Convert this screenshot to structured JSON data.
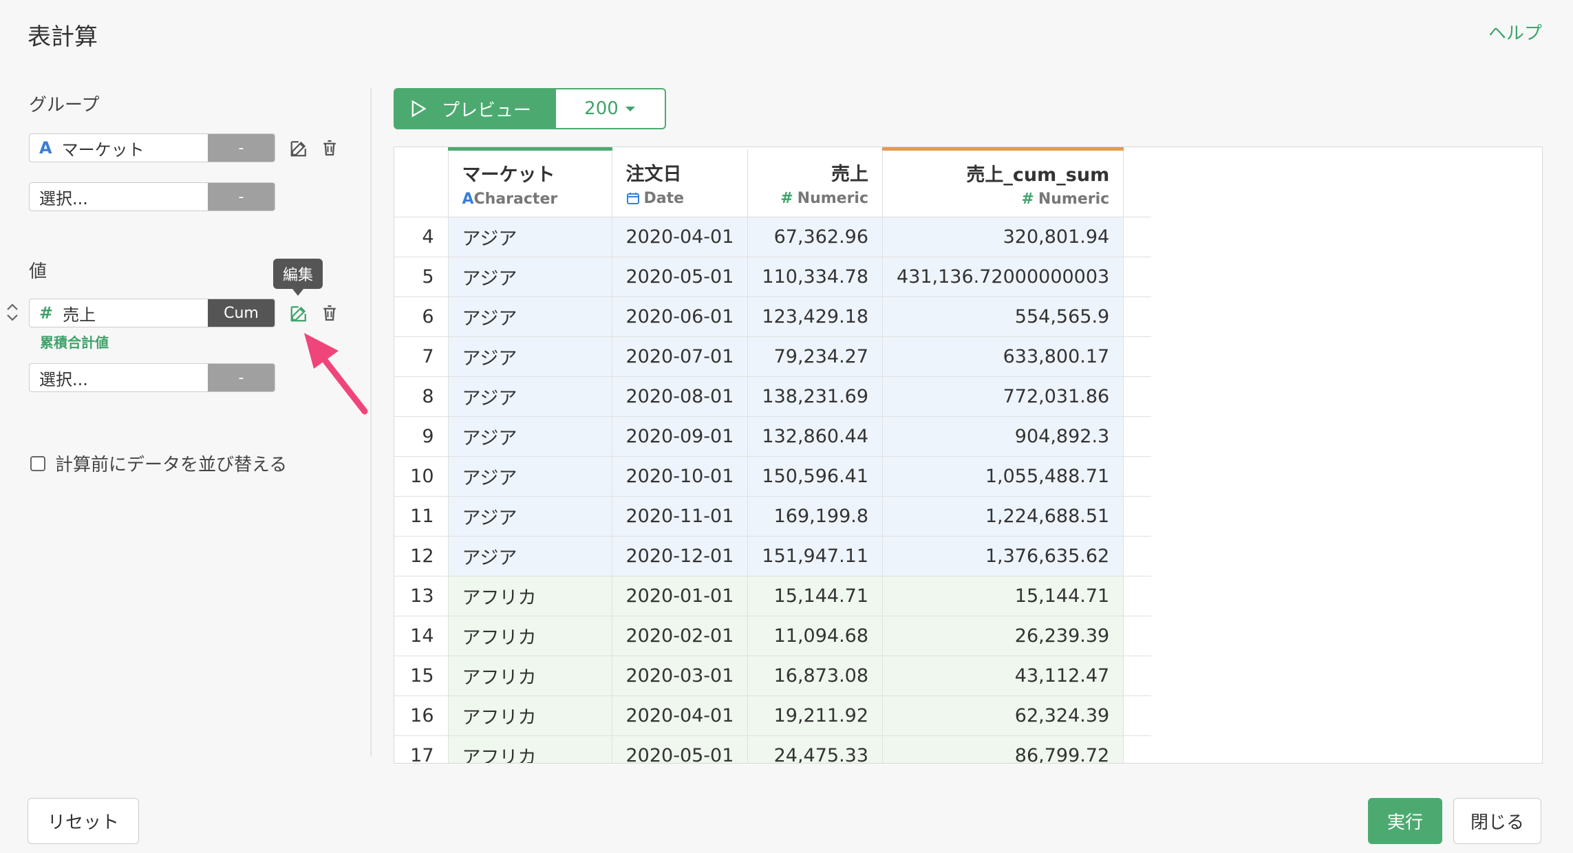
{
  "header": {
    "title": "表計算",
    "help": "ヘルプ"
  },
  "left": {
    "group_label": "グループ",
    "group_field": {
      "name": "マーケット",
      "type_icon": "A",
      "agg": "-"
    },
    "group_select": {
      "placeholder": "選択...",
      "agg": "-"
    },
    "value_label": "値",
    "tooltip": "編集",
    "value_field": {
      "name": "売上",
      "type_icon": "#",
      "agg": "Cum",
      "sublabel": "累積合計値"
    },
    "value_select": {
      "placeholder": "選択...",
      "agg": "-"
    },
    "sort_checkbox": {
      "label": "計算前にデータを並び替える",
      "checked": false
    }
  },
  "preview": {
    "label": "プレビュー",
    "count": "200"
  },
  "table": {
    "columns": [
      {
        "name": "マーケット",
        "type": "Character",
        "type_icon": "A"
      },
      {
        "name": "注文日",
        "type": "Date",
        "type_icon": "calendar"
      },
      {
        "name": "売上",
        "type": "Numeric",
        "type_icon": "#"
      },
      {
        "name": "売上_cum_sum",
        "type": "Numeric",
        "type_icon": "#"
      }
    ],
    "rows": [
      {
        "n": "4",
        "market": "アジア",
        "date": "2020-04-01",
        "sales": "67,362.96",
        "cum": "320,801.94",
        "group": "asia"
      },
      {
        "n": "5",
        "market": "アジア",
        "date": "2020-05-01",
        "sales": "110,334.78",
        "cum": "431,136.72000000003",
        "group": "asia"
      },
      {
        "n": "6",
        "market": "アジア",
        "date": "2020-06-01",
        "sales": "123,429.18",
        "cum": "554,565.9",
        "group": "asia"
      },
      {
        "n": "7",
        "market": "アジア",
        "date": "2020-07-01",
        "sales": "79,234.27",
        "cum": "633,800.17",
        "group": "asia"
      },
      {
        "n": "8",
        "market": "アジア",
        "date": "2020-08-01",
        "sales": "138,231.69",
        "cum": "772,031.86",
        "group": "asia"
      },
      {
        "n": "9",
        "market": "アジア",
        "date": "2020-09-01",
        "sales": "132,860.44",
        "cum": "904,892.3",
        "group": "asia"
      },
      {
        "n": "10",
        "market": "アジア",
        "date": "2020-10-01",
        "sales": "150,596.41",
        "cum": "1,055,488.71",
        "group": "asia"
      },
      {
        "n": "11",
        "market": "アジア",
        "date": "2020-11-01",
        "sales": "169,199.8",
        "cum": "1,224,688.51",
        "group": "asia"
      },
      {
        "n": "12",
        "market": "アジア",
        "date": "2020-12-01",
        "sales": "151,947.11",
        "cum": "1,376,635.62",
        "group": "asia"
      },
      {
        "n": "13",
        "market": "アフリカ",
        "date": "2020-01-01",
        "sales": "15,144.71",
        "cum": "15,144.71",
        "group": "africa"
      },
      {
        "n": "14",
        "market": "アフリカ",
        "date": "2020-02-01",
        "sales": "11,094.68",
        "cum": "26,239.39",
        "group": "africa"
      },
      {
        "n": "15",
        "market": "アフリカ",
        "date": "2020-03-01",
        "sales": "16,873.08",
        "cum": "43,112.47",
        "group": "africa"
      },
      {
        "n": "16",
        "market": "アフリカ",
        "date": "2020-04-01",
        "sales": "19,211.92",
        "cum": "62,324.39",
        "group": "africa"
      },
      {
        "n": "17",
        "market": "アフリカ",
        "date": "2020-05-01",
        "sales": "24,475.33",
        "cum": "86,799.72",
        "group": "africa"
      }
    ]
  },
  "footer": {
    "reset": "リセット",
    "run": "実行",
    "close": "閉じる"
  },
  "colors": {
    "accent": "#4caa70",
    "asia_row": "#eef4fc",
    "africa_row": "#eff7ee",
    "arrow": "#f0457a"
  }
}
